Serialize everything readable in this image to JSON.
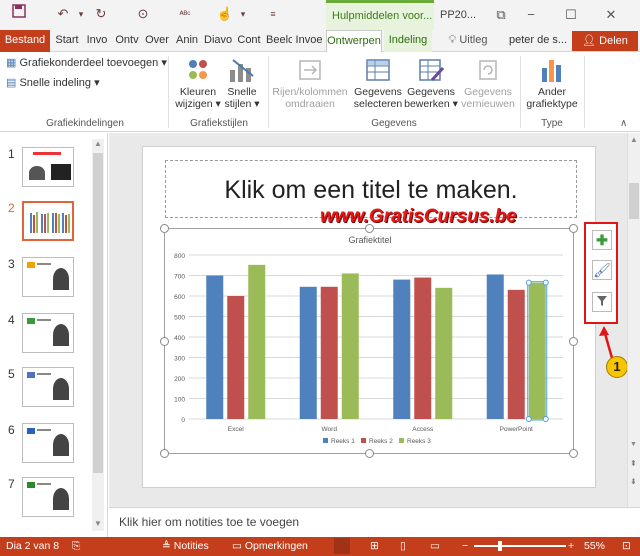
{
  "titlebar": {
    "context_tab": "Hulpmiddelen voor...",
    "doc_title": "PP20..."
  },
  "tabs": [
    {
      "label": "Bestand"
    },
    {
      "label": "Start"
    },
    {
      "label": "Invo"
    },
    {
      "label": "Ontv"
    },
    {
      "label": "Over"
    },
    {
      "label": "Anin"
    },
    {
      "label": "Diavo"
    },
    {
      "label": "Cont"
    },
    {
      "label": "Beelc"
    },
    {
      "label": "Invoe"
    },
    {
      "label": "Ontwerpen"
    },
    {
      "label": "Indeling"
    },
    {
      "label": "Uitleg"
    },
    {
      "label": "peter de s..."
    },
    {
      "label": "Delen"
    }
  ],
  "ribbon": {
    "add_element": "Grafiekonderdeel toevoegen",
    "quick_layout": "Snelle indeling",
    "group_layouts": "Grafiekindelingen",
    "colors_line1": "Kleuren",
    "colors_line2": "wijzigen",
    "styles_line1": "Snelle",
    "styles_line2": "stijlen",
    "group_styles": "Grafiekstijlen",
    "switch_line1": "Rijen/kolommen",
    "switch_line2": "omdraaien",
    "select_line1": "Gegevens",
    "select_line2": "selecteren",
    "edit_line1": "Gegevens",
    "edit_line2": "bewerken",
    "refresh_line1": "Gegevens",
    "refresh_line2": "vernieuwen",
    "group_data": "Gegevens",
    "change_type_line1": "Ander",
    "change_type_line2": "grafiektype",
    "group_type": "Type"
  },
  "slides": [
    "1",
    "2",
    "3",
    "4",
    "5",
    "6",
    "7"
  ],
  "slide": {
    "title_placeholder": "Klik om een titel te maken.",
    "watermark": "www.GratisCursus.be"
  },
  "callout_number": "1",
  "notes_placeholder": "Klik hier om notities toe te voegen",
  "status": {
    "slide_of": "Dia 2 van 8",
    "notes": "Notities",
    "comments": "Opmerkingen",
    "zoom": "55%"
  },
  "chart_data": {
    "type": "bar",
    "title": "Grafiektitel",
    "categories": [
      "Excel",
      "Word",
      "Access",
      "PowerPoint"
    ],
    "ylim": [
      0,
      800
    ],
    "yticks": [
      0,
      100,
      200,
      300,
      400,
      500,
      600,
      700,
      800
    ],
    "grid": true,
    "legend_position": "bottom",
    "series": [
      {
        "name": "Reeks 1",
        "color": "#4f81bd",
        "values": [
          700,
          645,
          680,
          705
        ]
      },
      {
        "name": "Reeks 2",
        "color": "#c0504d",
        "values": [
          600,
          645,
          690,
          630
        ]
      },
      {
        "name": "Reeks 3",
        "color": "#9bbb59",
        "values": [
          752,
          710,
          640,
          665
        ]
      }
    ]
  }
}
